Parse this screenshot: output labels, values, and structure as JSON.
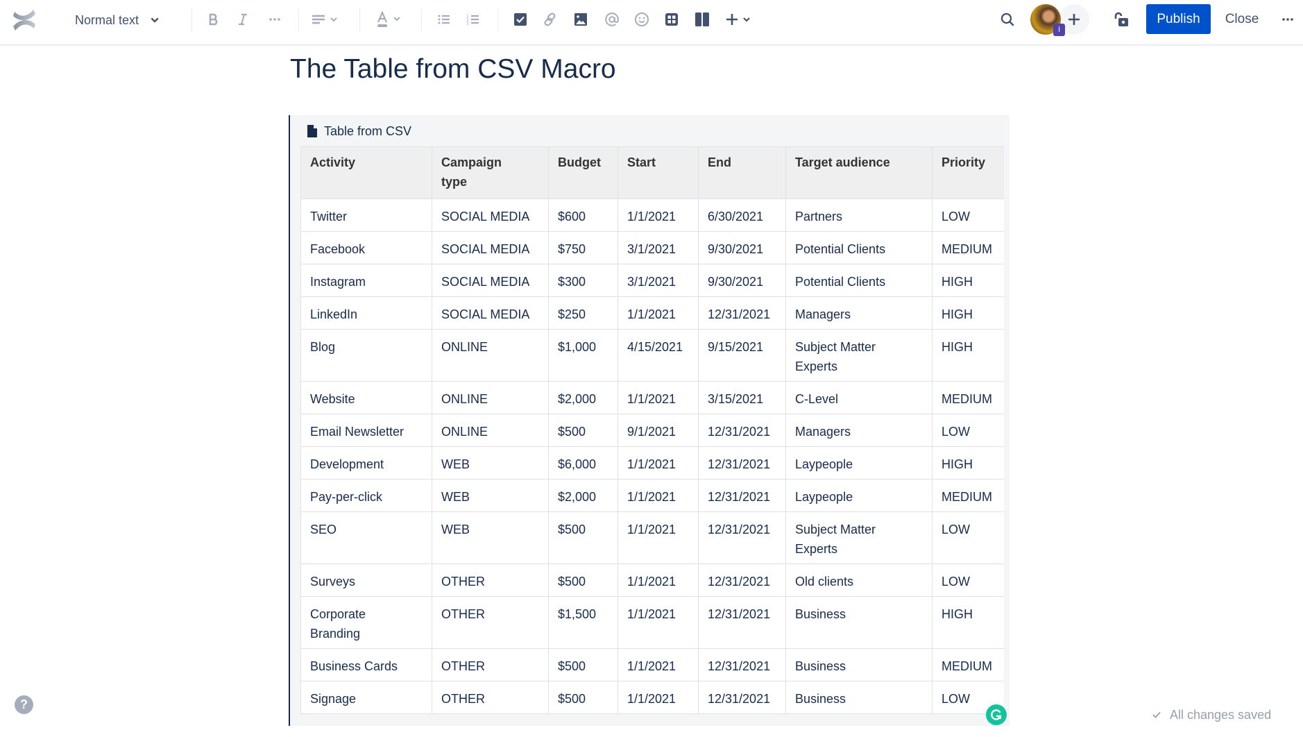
{
  "toolbar": {
    "text_style": "Normal text",
    "icons": {
      "logo": "confluence-logo",
      "bold": "bold-icon",
      "italic": "italic-icon",
      "more_formatting": "more-formatting-icon",
      "alignment": "align-left-icon",
      "text_color": "text-color-icon",
      "bullet_list": "bullet-list-icon",
      "numbered_list": "numbered-list-icon",
      "action_item": "checkbox-icon",
      "link": "link-icon",
      "image": "image-icon",
      "mention": "mention-icon",
      "emoji": "emoji-icon",
      "table": "table-icon",
      "layouts": "layout-icon",
      "insert": "plus-icon"
    },
    "avatar_badge": "I",
    "publish_label": "Publish",
    "close_label": "Close"
  },
  "page": {
    "title": "The Table from CSV Macro"
  },
  "macro": {
    "title": "Table from CSV",
    "table": {
      "headers": [
        "Activity",
        "Campaign type",
        "Budget",
        "Start",
        "End",
        "Target audience",
        "Priority"
      ],
      "rows": [
        [
          "Twitter",
          "SOCIAL MEDIA",
          "$600",
          "1/1/2021",
          "6/30/2021",
          "Partners",
          "LOW"
        ],
        [
          "Facebook",
          "SOCIAL MEDIA",
          "$750",
          "3/1/2021",
          "9/30/2021",
          "Potential Clients",
          "MEDIUM"
        ],
        [
          "Instagram",
          "SOCIAL MEDIA",
          "$300",
          "3/1/2021",
          "9/30/2021",
          "Potential Clients",
          "HIGH"
        ],
        [
          "LinkedIn",
          "SOCIAL MEDIA",
          "$250",
          "1/1/2021",
          "12/31/2021",
          "Managers",
          "HIGH"
        ],
        [
          "Blog",
          "ONLINE",
          "$1,000",
          "4/15/2021",
          "9/15/2021",
          "Subject Matter Experts",
          "HIGH"
        ],
        [
          "Website",
          "ONLINE",
          "$2,000",
          "1/1/2021",
          "3/15/2021",
          "C-Level",
          "MEDIUM"
        ],
        [
          "Email Newsletter",
          "ONLINE",
          "$500",
          "9/1/2021",
          "12/31/2021",
          "Managers",
          "LOW"
        ],
        [
          "Development",
          "WEB",
          "$6,000",
          "1/1/2021",
          "12/31/2021",
          "Laypeople",
          "HIGH"
        ],
        [
          "Pay-per-click",
          "WEB",
          "$2,000",
          "1/1/2021",
          "12/31/2021",
          "Laypeople",
          "MEDIUM"
        ],
        [
          "SEO",
          "WEB",
          "$500",
          "1/1/2021",
          "12/31/2021",
          "Subject Matter Experts",
          "LOW"
        ],
        [
          "Surveys",
          "OTHER",
          "$500",
          "1/1/2021",
          "12/31/2021",
          "Old clients",
          "LOW"
        ],
        [
          "Corporate Branding",
          "OTHER",
          "$1,500",
          "1/1/2021",
          "12/31/2021",
          "Business",
          "HIGH"
        ],
        [
          "Business Cards",
          "OTHER",
          "$500",
          "1/1/2021",
          "12/31/2021",
          "Business",
          "MEDIUM"
        ],
        [
          "Signage",
          "OTHER",
          "$500",
          "1/1/2021",
          "12/31/2021",
          "Business",
          "LOW"
        ]
      ]
    }
  },
  "footer": {
    "status": "All changes saved",
    "help": "?"
  },
  "colors": {
    "accent": "#0052cc",
    "text": "#172b4d",
    "icon_dark": "#42526e",
    "icon_disabled": "#a5adba",
    "grammarly": "#15c39a",
    "badge": "#5243aa"
  }
}
